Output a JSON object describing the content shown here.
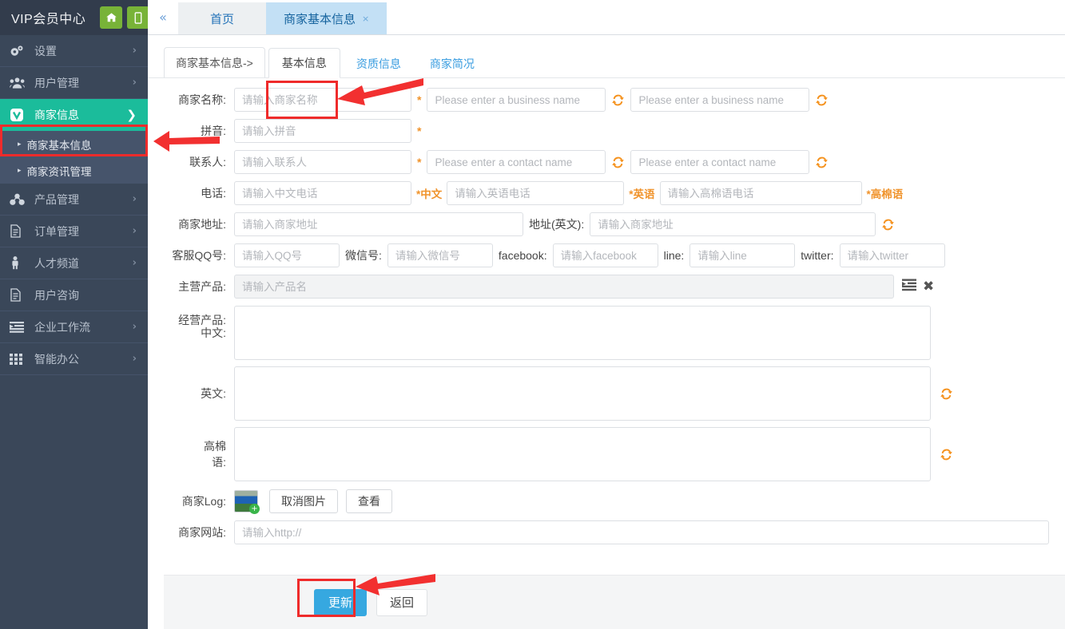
{
  "brand": {
    "title": "VIP会员中心",
    "buttons": [
      {
        "name": "home-icon",
        "label": ""
      },
      {
        "name": "mobile-icon",
        "label": ""
      }
    ]
  },
  "sidebar": {
    "items": [
      {
        "label": "设置",
        "icon": "gears-icon",
        "arrow": "›",
        "active": false
      },
      {
        "label": "用户管理",
        "icon": "users-icon",
        "arrow": "›",
        "active": false
      },
      {
        "label": "商家信息",
        "icon": "v-badge-icon",
        "arrow": "❯",
        "active": true
      },
      {
        "label": "产品管理",
        "icon": "cubes-icon",
        "arrow": "›",
        "active": false
      },
      {
        "label": "订单管理",
        "icon": "file-icon",
        "arrow": "›",
        "active": false
      },
      {
        "label": "人才频道",
        "icon": "person-icon",
        "arrow": "›",
        "active": false
      },
      {
        "label": "用户咨询",
        "icon": "file-icon",
        "arrow": "",
        "active": false
      },
      {
        "label": "企业工作流",
        "icon": "flow-icon",
        "arrow": "›",
        "active": false
      },
      {
        "label": "智能办公",
        "icon": "grid-icon",
        "arrow": "›",
        "active": false
      }
    ],
    "submenu": [
      {
        "label": "商家基本信息",
        "marker": "▸",
        "highlighted": true
      },
      {
        "label": "商家资讯管理",
        "marker": "▸",
        "highlighted": false
      }
    ]
  },
  "tabbar": {
    "collapse_icon": "«",
    "tabs": [
      {
        "label": "首页",
        "closable": false,
        "active": false
      },
      {
        "label": "商家基本信息",
        "closable": true,
        "close_icon": "×",
        "active": true
      }
    ]
  },
  "breadcrumb": {
    "text": "商家基本信息->",
    "subtabs": [
      {
        "label": "基本信息",
        "active": true
      },
      {
        "label": "资质信息",
        "active": false
      },
      {
        "label": "商家简况",
        "active": false
      }
    ]
  },
  "form": {
    "business_name": {
      "label": "商家名称:",
      "cn_placeholder": "请输入商家名称",
      "star": "*",
      "en_placeholder": "Please enter a business name",
      "kh_placeholder": "Please enter a business name",
      "refresh_icon": "↻"
    },
    "pinyin": {
      "label": "拼音:",
      "placeholder": "请输入拼音",
      "star": "*"
    },
    "contact": {
      "label": "联系人:",
      "cn_placeholder": "请输入联系人",
      "star": "*",
      "en_placeholder": "Please enter a contact name",
      "kh_placeholder": "Please enter a contact name"
    },
    "phone": {
      "label": "电话:",
      "cn_placeholder": "请输入中文电话",
      "cn_tag": "*中文",
      "en_placeholder": "请输入英语电话",
      "en_tag": "*英语",
      "kh_placeholder": "请输入高棉语电话",
      "kh_tag": "*高棉语"
    },
    "address": {
      "label": "商家地址:",
      "cn_placeholder": "请输入商家地址",
      "en_label": "地址(英文):",
      "en_placeholder": "请输入商家地址"
    },
    "social": {
      "qq_label": "客服QQ号:",
      "qq_placeholder": "请输入QQ号",
      "wechat_label": "微信号:",
      "wechat_placeholder": "请输入微信号",
      "facebook_label": "facebook:",
      "facebook_placeholder": "请输入facebook",
      "line_label": "line:",
      "line_placeholder": "请输入line",
      "twitter_label": "twitter:",
      "twitter_placeholder": "请输入twitter"
    },
    "main_product": {
      "label": "主营产品:",
      "placeholder": "请输入产品名",
      "list_icon": "☰",
      "clear_icon": "✖"
    },
    "business_products": {
      "label": "经营产品:",
      "cn_label": "中文:",
      "en_label": "英文:",
      "kh_label": "高棉语:",
      "cn_value": "",
      "en_value": "",
      "kh_value": ""
    },
    "logo": {
      "label": "商家Log:",
      "thumb_icon": "image-add-icon",
      "cancel_label": "取消图片",
      "view_label": "查看"
    },
    "website": {
      "label": "商家网站:",
      "placeholder": "请输入http://"
    }
  },
  "footer": {
    "update_label": "更新",
    "back_label": "返回"
  },
  "colors": {
    "sidebar_bg": "#3a4759",
    "sidebar_header": "#323c4c",
    "accent_green": "#1bbc9b",
    "brand_btn_green": "#78b338",
    "primary_blue": "#36a8e0",
    "tab_active_blue": "#c3e0f5",
    "required_orange": "#f0932b",
    "annotation_red": "#ef2b2b",
    "submenu_bg": "#46546b"
  }
}
